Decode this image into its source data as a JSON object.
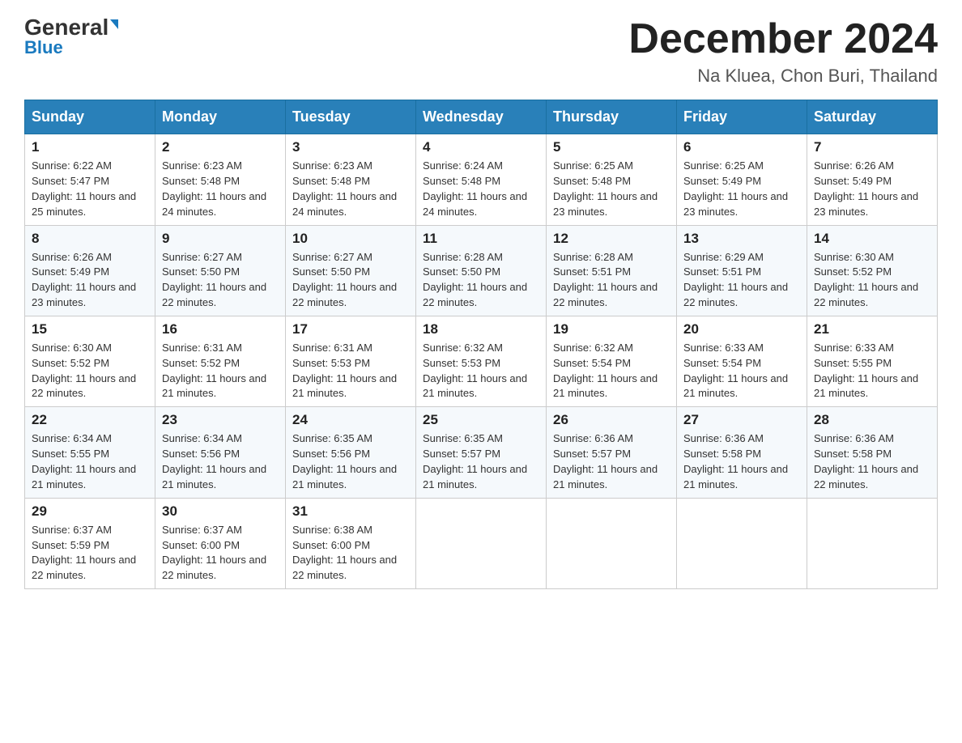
{
  "header": {
    "logo_general": "General",
    "logo_blue": "Blue",
    "month_title": "December 2024",
    "location": "Na Kluea, Chon Buri, Thailand"
  },
  "weekdays": [
    "Sunday",
    "Monday",
    "Tuesday",
    "Wednesday",
    "Thursday",
    "Friday",
    "Saturday"
  ],
  "weeks": [
    [
      {
        "day": "1",
        "sunrise": "6:22 AM",
        "sunset": "5:47 PM",
        "daylight": "11 hours and 25 minutes."
      },
      {
        "day": "2",
        "sunrise": "6:23 AM",
        "sunset": "5:48 PM",
        "daylight": "11 hours and 24 minutes."
      },
      {
        "day": "3",
        "sunrise": "6:23 AM",
        "sunset": "5:48 PM",
        "daylight": "11 hours and 24 minutes."
      },
      {
        "day": "4",
        "sunrise": "6:24 AM",
        "sunset": "5:48 PM",
        "daylight": "11 hours and 24 minutes."
      },
      {
        "day": "5",
        "sunrise": "6:25 AM",
        "sunset": "5:48 PM",
        "daylight": "11 hours and 23 minutes."
      },
      {
        "day": "6",
        "sunrise": "6:25 AM",
        "sunset": "5:49 PM",
        "daylight": "11 hours and 23 minutes."
      },
      {
        "day": "7",
        "sunrise": "6:26 AM",
        "sunset": "5:49 PM",
        "daylight": "11 hours and 23 minutes."
      }
    ],
    [
      {
        "day": "8",
        "sunrise": "6:26 AM",
        "sunset": "5:49 PM",
        "daylight": "11 hours and 23 minutes."
      },
      {
        "day": "9",
        "sunrise": "6:27 AM",
        "sunset": "5:50 PM",
        "daylight": "11 hours and 22 minutes."
      },
      {
        "day": "10",
        "sunrise": "6:27 AM",
        "sunset": "5:50 PM",
        "daylight": "11 hours and 22 minutes."
      },
      {
        "day": "11",
        "sunrise": "6:28 AM",
        "sunset": "5:50 PM",
        "daylight": "11 hours and 22 minutes."
      },
      {
        "day": "12",
        "sunrise": "6:28 AM",
        "sunset": "5:51 PM",
        "daylight": "11 hours and 22 minutes."
      },
      {
        "day": "13",
        "sunrise": "6:29 AM",
        "sunset": "5:51 PM",
        "daylight": "11 hours and 22 minutes."
      },
      {
        "day": "14",
        "sunrise": "6:30 AM",
        "sunset": "5:52 PM",
        "daylight": "11 hours and 22 minutes."
      }
    ],
    [
      {
        "day": "15",
        "sunrise": "6:30 AM",
        "sunset": "5:52 PM",
        "daylight": "11 hours and 22 minutes."
      },
      {
        "day": "16",
        "sunrise": "6:31 AM",
        "sunset": "5:52 PM",
        "daylight": "11 hours and 21 minutes."
      },
      {
        "day": "17",
        "sunrise": "6:31 AM",
        "sunset": "5:53 PM",
        "daylight": "11 hours and 21 minutes."
      },
      {
        "day": "18",
        "sunrise": "6:32 AM",
        "sunset": "5:53 PM",
        "daylight": "11 hours and 21 minutes."
      },
      {
        "day": "19",
        "sunrise": "6:32 AM",
        "sunset": "5:54 PM",
        "daylight": "11 hours and 21 minutes."
      },
      {
        "day": "20",
        "sunrise": "6:33 AM",
        "sunset": "5:54 PM",
        "daylight": "11 hours and 21 minutes."
      },
      {
        "day": "21",
        "sunrise": "6:33 AM",
        "sunset": "5:55 PM",
        "daylight": "11 hours and 21 minutes."
      }
    ],
    [
      {
        "day": "22",
        "sunrise": "6:34 AM",
        "sunset": "5:55 PM",
        "daylight": "11 hours and 21 minutes."
      },
      {
        "day": "23",
        "sunrise": "6:34 AM",
        "sunset": "5:56 PM",
        "daylight": "11 hours and 21 minutes."
      },
      {
        "day": "24",
        "sunrise": "6:35 AM",
        "sunset": "5:56 PM",
        "daylight": "11 hours and 21 minutes."
      },
      {
        "day": "25",
        "sunrise": "6:35 AM",
        "sunset": "5:57 PM",
        "daylight": "11 hours and 21 minutes."
      },
      {
        "day": "26",
        "sunrise": "6:36 AM",
        "sunset": "5:57 PM",
        "daylight": "11 hours and 21 minutes."
      },
      {
        "day": "27",
        "sunrise": "6:36 AM",
        "sunset": "5:58 PM",
        "daylight": "11 hours and 21 minutes."
      },
      {
        "day": "28",
        "sunrise": "6:36 AM",
        "sunset": "5:58 PM",
        "daylight": "11 hours and 22 minutes."
      }
    ],
    [
      {
        "day": "29",
        "sunrise": "6:37 AM",
        "sunset": "5:59 PM",
        "daylight": "11 hours and 22 minutes."
      },
      {
        "day": "30",
        "sunrise": "6:37 AM",
        "sunset": "6:00 PM",
        "daylight": "11 hours and 22 minutes."
      },
      {
        "day": "31",
        "sunrise": "6:38 AM",
        "sunset": "6:00 PM",
        "daylight": "11 hours and 22 minutes."
      },
      null,
      null,
      null,
      null
    ]
  ]
}
